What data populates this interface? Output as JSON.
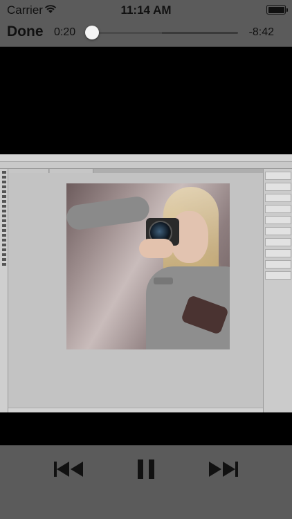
{
  "status_bar": {
    "carrier": "Carrier",
    "time": "11:14 AM",
    "wifi_icon": "wifi-icon",
    "battery_icon": "battery-icon",
    "battery_level": 1.0
  },
  "player": {
    "done_label": "Done",
    "elapsed": "0:20",
    "remaining": "-8:42",
    "progress": 0.04
  },
  "video": {
    "content": "Photoshop screencast with photo of woman holding camera"
  },
  "controls": {
    "previous_icon": "skip-back-icon",
    "pause_icon": "pause-icon",
    "next_icon": "skip-forward-icon"
  },
  "colors": {
    "chrome": "#5b5b5b",
    "text": "#111111",
    "video_bg": "#000000"
  }
}
